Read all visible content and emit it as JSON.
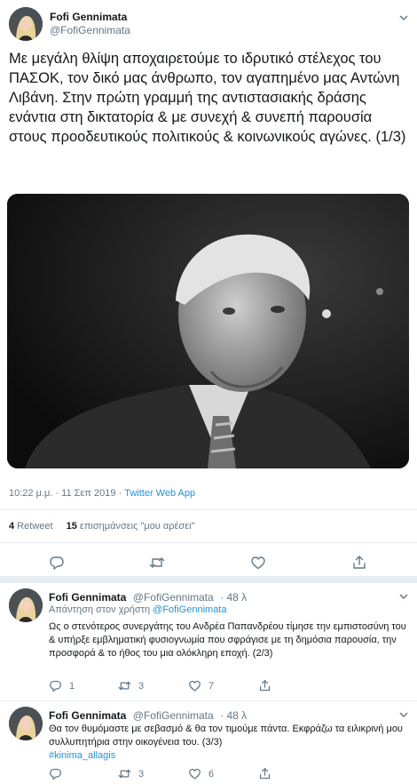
{
  "main_tweet": {
    "author_name": "Fofi Gennimata",
    "author_handle": "@FofiGennimata",
    "text": "Με μεγάλη θλίψη αποχαιρετούμε το ιδρυτικό στέλεχος του ΠΑΣΟΚ, τον δικό μας άνθρωπο, τον αγαπημένο μας Αντώνη Λιβάνη. Στην πρώτη γραμμή της αντιστασιακής δράσης ενάντια στη δικτατορία & με συνεχή & συνεπή παρουσία στους προοδευτικούς πολιτικούς & κοινωνικούς αγώνες. (1/3)",
    "timestamp": "10:22 μ.μ. · 11 Σεπ 2019 · ",
    "source_app": "Twitter Web App",
    "retweets_count": "4",
    "retweets_label": " Retweet",
    "likes_count": "15",
    "likes_label": " επισημάνσεις \"μου αρέσει\""
  },
  "replies": [
    {
      "author_name": "Fofi Gennimata",
      "author_handle": "@FofiGennimata",
      "time": "· 48 λ",
      "replying_prefix": "Απάντηση στον χρήστη ",
      "replying_to": "@FofiGennimata",
      "text": "Ως ο στενότερος συνεργάτης του Ανδρέα Παπανδρέου τίμησε την εμπιστοσύνη του & υπήρξε εμβληματική φυσιογνωμία που σφράγισε με τη δημόσια παρουσία, την προσφορά & το ήθος του μια ολόκληρη εποχή. (2/3)",
      "reply_count": "1",
      "retweet_count": "3",
      "like_count": "7"
    },
    {
      "author_name": "Fofi Gennimata",
      "author_handle": "@FofiGennimata",
      "time": "· 48 λ",
      "text": "Θα τον θυμόμαστε με σεβασμό & θα τον τιμούμε πάντα. Εκφράζω τα ειλικρινή μου συλλυπητήρια στην οικογένεια του. (3/3)",
      "hashtag": "#kinima_allagis",
      "reply_count": "",
      "retweet_count": "3",
      "like_count": "6"
    }
  ],
  "icons": {
    "reply": "reply-icon",
    "retweet": "retweet-icon",
    "like": "heart-icon",
    "share": "share-icon",
    "more": "chevron-down-icon"
  },
  "colors": {
    "link": "#1b95e0",
    "secondary_text": "#657786",
    "icon": "#657786",
    "divider": "#e6ecf0"
  }
}
